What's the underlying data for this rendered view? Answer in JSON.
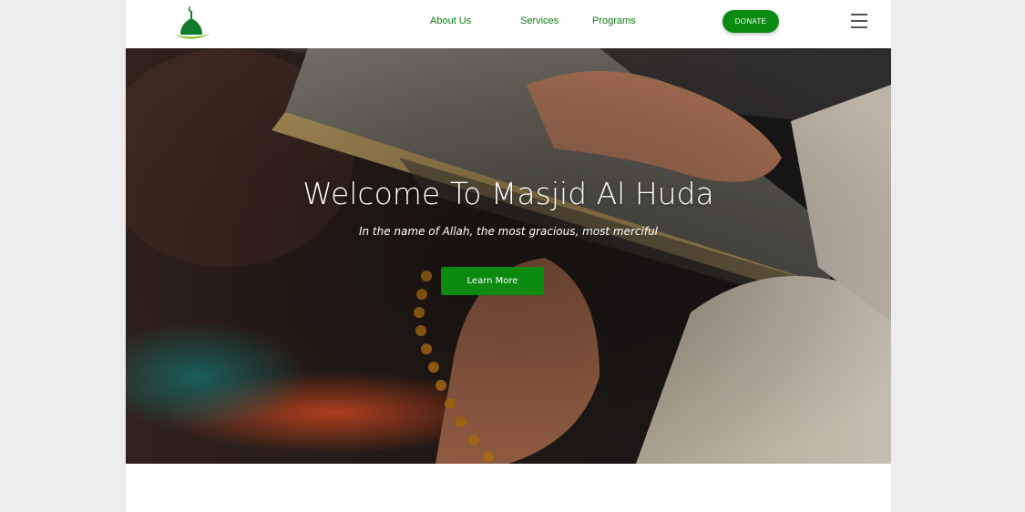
{
  "site": {
    "logo_icon": "mosque-dome-icon",
    "brand_color": "#0b8a10"
  },
  "nav": {
    "links": [
      {
        "label": "About Us"
      },
      {
        "label": "Services"
      },
      {
        "label": "Programs"
      }
    ],
    "donate_label": "DONATE",
    "menu_icon": "hamburger-menu-icon"
  },
  "hero": {
    "title": "Welcome To Masjid Al Huda",
    "subtitle": "In the name of Allah, the most gracious, most merciful",
    "cta_label": "Learn More",
    "background": "hands-holding-quran-photo"
  }
}
